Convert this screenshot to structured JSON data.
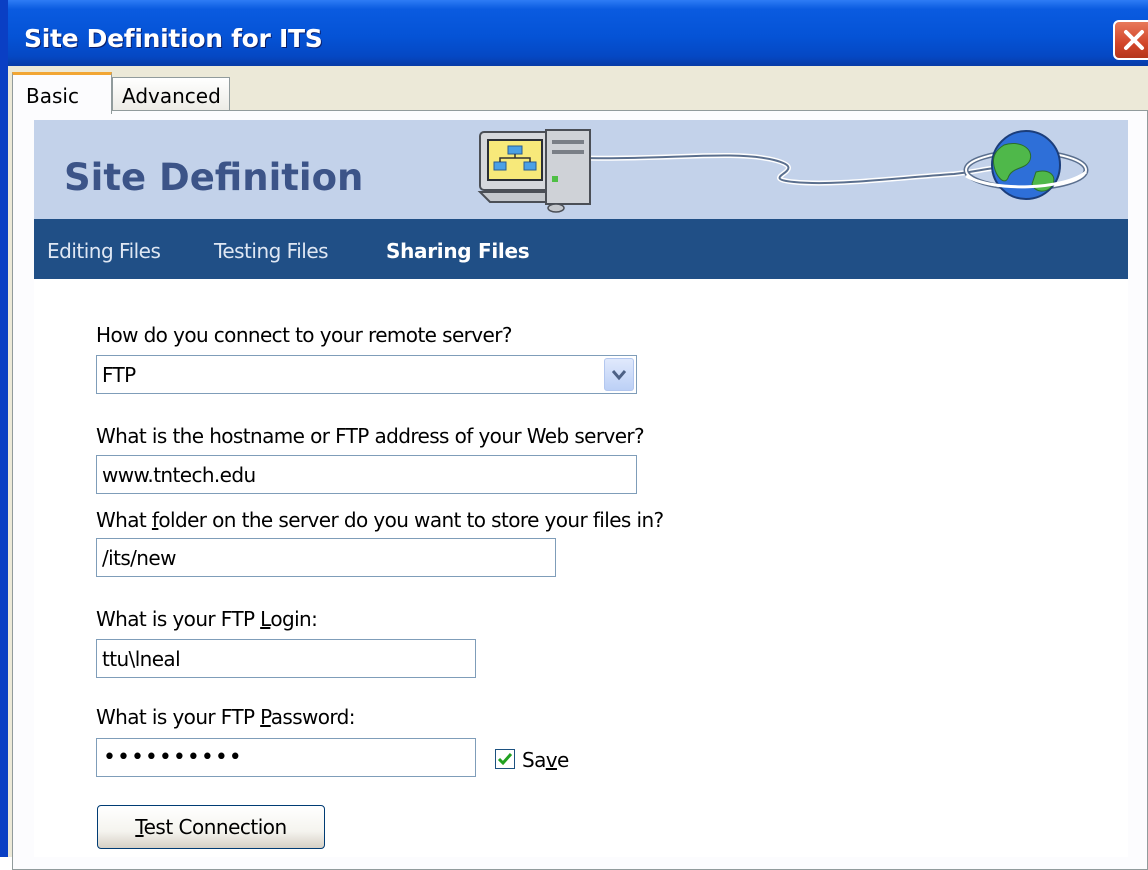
{
  "window": {
    "title": "Site Definition for ITS"
  },
  "tabs": [
    {
      "label": "Basic",
      "selected": true
    },
    {
      "label": "Advanced",
      "selected": false
    }
  ],
  "banner": {
    "title": "Site Definition"
  },
  "nav": [
    {
      "label": "Editing Files",
      "active": false
    },
    {
      "label": "Testing Files",
      "active": false
    },
    {
      "label": "Sharing Files",
      "active": true
    }
  ],
  "form": {
    "connect_label": "How do you connect to your remote server?",
    "connect_value": "FTP",
    "host_label": "What is the hostname or FTP address of your Web server?",
    "host_value": "www.tntech.edu",
    "folder_label_pre": "What ",
    "folder_label_ul": "f",
    "folder_label_post": "older on the server do you want to store your files in?",
    "folder_value": "/its/new",
    "login_label_pre": "What is your FTP ",
    "login_label_ul": "L",
    "login_label_post": "ogin:",
    "login_value": "ttu\\lneal",
    "password_label_pre": "What is your FTP ",
    "password_label_ul": "P",
    "password_label_post": "assword:",
    "password_value": "••••••••••",
    "save_checked": true,
    "save_label_pre": "Sa",
    "save_label_ul": "v",
    "save_label_post": "e",
    "test_button_ul": "T",
    "test_button_post": "est Connection"
  },
  "colors": {
    "titlebar": "#0553d6",
    "banner": "#c3d2ea",
    "navbar": "#204f86",
    "banner_title": "#3c5488"
  },
  "icons": [
    "close-icon",
    "computer-icon",
    "globe-icon",
    "dropdown-arrow-icon",
    "checkmark-icon"
  ]
}
